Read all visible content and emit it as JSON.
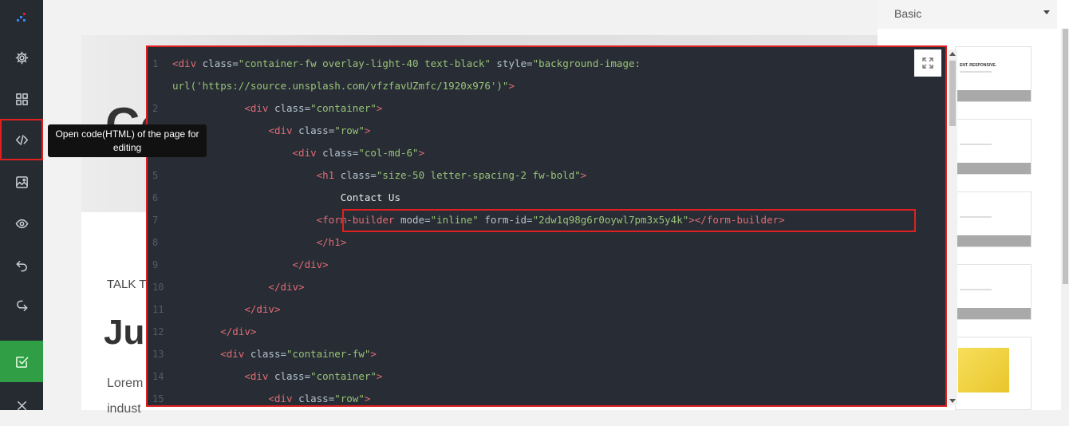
{
  "tooltip": {
    "text": "Open code(HTML) of the page for editing"
  },
  "page": {
    "hero_title": "Co",
    "talk_text": "TALK T",
    "heading": "Jus",
    "lorem": "Lorem",
    "industry": "indust"
  },
  "right_panel": {
    "category": "Basic",
    "thumb1_title": "ENT. RESPONSIVE."
  },
  "editor": {
    "lines": [
      {
        "num": "1",
        "parts": [
          [
            "tag",
            "<div "
          ],
          [
            "attr",
            "class="
          ],
          [
            "val",
            "\"container-fw overlay-light-40 text-black\""
          ],
          [
            "attr",
            " style="
          ],
          [
            "val",
            "\"background-image:"
          ]
        ]
      },
      {
        "num": "",
        "parts": [
          [
            "val",
            "url('https://source.unsplash.com/vfzfavUZmfc/1920x976')\""
          ],
          [
            "tag",
            ">"
          ]
        ]
      },
      {
        "num": "2",
        "parts": [
          [
            "txt",
            "            "
          ],
          [
            "tag",
            "<div "
          ],
          [
            "attr",
            "class="
          ],
          [
            "val",
            "\"container\""
          ],
          [
            "tag",
            ">"
          ]
        ]
      },
      {
        "num": "3",
        "parts": [
          [
            "txt",
            "                "
          ],
          [
            "tag",
            "<div "
          ],
          [
            "attr",
            "class="
          ],
          [
            "val",
            "\"row\""
          ],
          [
            "tag",
            ">"
          ]
        ]
      },
      {
        "num": "4",
        "parts": [
          [
            "txt",
            "                    "
          ],
          [
            "tag",
            "<div "
          ],
          [
            "attr",
            "class="
          ],
          [
            "val",
            "\"col-md-6\""
          ],
          [
            "tag",
            ">"
          ]
        ]
      },
      {
        "num": "5",
        "parts": [
          [
            "txt",
            "                        "
          ],
          [
            "tag",
            "<h1 "
          ],
          [
            "attr",
            "class="
          ],
          [
            "val",
            "\"size-50 letter-spacing-2 fw-bold\""
          ],
          [
            "tag",
            ">"
          ]
        ]
      },
      {
        "num": "6",
        "parts": [
          [
            "txt",
            "                            Contact Us"
          ]
        ]
      },
      {
        "num": "7",
        "parts": [
          [
            "txt",
            "                        "
          ],
          [
            "tag",
            "<form-builder "
          ],
          [
            "attr",
            "mode="
          ],
          [
            "val",
            "\"inline\""
          ],
          [
            "attr",
            " form-id="
          ],
          [
            "val",
            "\"2dw1q98g6r0oywl7pm3x5y4k\""
          ],
          [
            "tag",
            "></form-builder>"
          ]
        ]
      },
      {
        "num": "8",
        "parts": [
          [
            "txt",
            "                        "
          ],
          [
            "tag",
            "</h1>"
          ]
        ]
      },
      {
        "num": "9",
        "parts": [
          [
            "txt",
            "                    "
          ],
          [
            "tag",
            "</div>"
          ]
        ]
      },
      {
        "num": "10",
        "parts": [
          [
            "txt",
            "                "
          ],
          [
            "tag",
            "</div>"
          ]
        ]
      },
      {
        "num": "11",
        "parts": [
          [
            "txt",
            "            "
          ],
          [
            "tag",
            "</div>"
          ]
        ]
      },
      {
        "num": "12",
        "parts": [
          [
            "txt",
            "        "
          ],
          [
            "tag",
            "</div>"
          ]
        ]
      },
      {
        "num": "13",
        "parts": [
          [
            "txt",
            "        "
          ],
          [
            "tag",
            "<div "
          ],
          [
            "attr",
            "class="
          ],
          [
            "val",
            "\"container-fw\""
          ],
          [
            "tag",
            ">"
          ]
        ]
      },
      {
        "num": "14",
        "parts": [
          [
            "txt",
            "            "
          ],
          [
            "tag",
            "<div "
          ],
          [
            "attr",
            "class="
          ],
          [
            "val",
            "\"container\""
          ],
          [
            "tag",
            ">"
          ]
        ]
      },
      {
        "num": "15",
        "parts": [
          [
            "txt",
            "                "
          ],
          [
            "tag",
            "<div "
          ],
          [
            "attr",
            "class="
          ],
          [
            "val",
            "\"row\""
          ],
          [
            "tag",
            ">"
          ]
        ]
      }
    ]
  },
  "sidebar": {
    "items": [
      {
        "name": "logo-icon",
        "icon": "logo"
      },
      {
        "name": "settings-icon",
        "icon": "gear"
      },
      {
        "name": "blocks-icon",
        "icon": "grid"
      },
      {
        "name": "code-icon",
        "icon": "code"
      },
      {
        "name": "image-icon",
        "icon": "image"
      },
      {
        "name": "preview-icon",
        "icon": "eye"
      },
      {
        "name": "undo-icon",
        "icon": "undo"
      },
      {
        "name": "redo-icon",
        "icon": "redo"
      },
      {
        "name": "save-icon",
        "icon": "check-square"
      },
      {
        "name": "close-icon",
        "icon": "x"
      }
    ]
  },
  "colors": {
    "sidebar_bg": "#252b31",
    "editor_bg": "#282c34",
    "highlight": "#e02020",
    "save_green": "#2f9e44"
  }
}
